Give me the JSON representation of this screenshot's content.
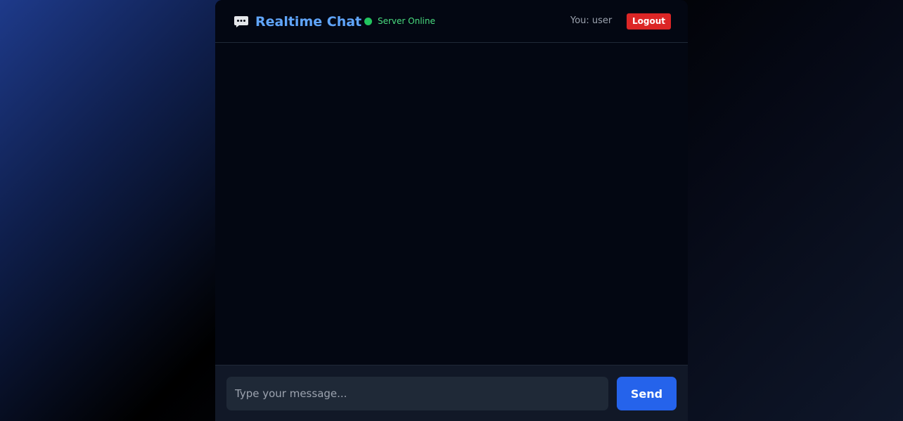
{
  "header": {
    "title": "Realtime Chat",
    "chat_icon": "chat-bubble-icon",
    "status_text": "Server Online",
    "status_color": "#22c55e",
    "user_label": "You: user",
    "logout_label": "Logout"
  },
  "composer": {
    "placeholder": "Type your message...",
    "value": "",
    "send_label": "Send"
  },
  "colors": {
    "accent": "#60a5fa",
    "primary_button": "#2563eb",
    "danger_button": "#dc2626"
  }
}
